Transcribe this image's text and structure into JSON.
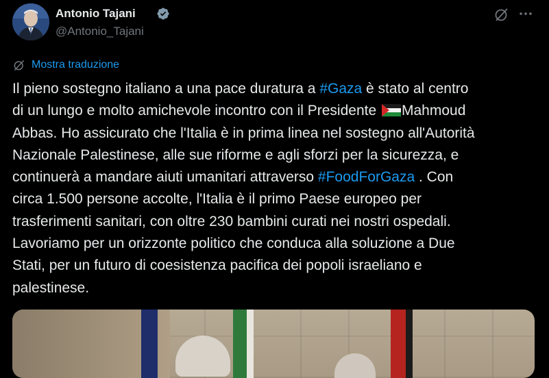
{
  "author": {
    "name": "Antonio Tajani",
    "handle": "@Antonio_Tajani"
  },
  "icons": {
    "verified": "verified-badge-icon",
    "grok": "grok-icon",
    "more": "more-options-icon",
    "translate": "translate-icon"
  },
  "translate_label": "Mostra traduzione",
  "tweet": {
    "lines": [
      {
        "parts": [
          {
            "t": "Il pieno sostegno italiano a una pace duratura a "
          },
          {
            "t": "#Gaza",
            "tag": true
          },
          {
            "t": " è stato al centro"
          }
        ]
      },
      {
        "parts": [
          {
            "t": "di un lungo e molto amichevole incontro con il Presidente "
          },
          {
            "flag": true
          },
          {
            "t": "Mahmoud"
          }
        ]
      },
      {
        "parts": [
          {
            "t": "Abbas. Ho assicurato che l'Italia è in prima linea nel sostegno all'Autorità"
          }
        ]
      },
      {
        "parts": [
          {
            "t": "Nazionale Palestinese, alle sue riforme e agli sforzi per la sicurezza, e"
          }
        ]
      },
      {
        "parts": [
          {
            "t": "continuerà a mandare aiuti umanitari attraverso "
          },
          {
            "t": "#FoodForGaza",
            "tag": true
          },
          {
            "t": " . Con"
          }
        ]
      },
      {
        "parts": [
          {
            "t": "circa 1.500 persone accolte, l'Italia è il primo Paese europeo per"
          }
        ]
      },
      {
        "parts": [
          {
            "t": "trasferimenti sanitari, con oltre 230 bambini curati nei nostri ospedali."
          }
        ]
      },
      {
        "parts": [
          {
            "t": "Lavoriamo per un orizzonte politico che conduca alla soluzione a Due"
          }
        ]
      },
      {
        "parts": [
          {
            "t": "Stati, per un futuro di coesistenza pacifica dei popoli israeliano e"
          }
        ]
      },
      {
        "parts": [
          {
            "t": "palestinese."
          }
        ]
      }
    ]
  },
  "colors": {
    "background": "#000000",
    "text": "#e7e9ea",
    "secondary": "#71767b",
    "accent": "#1d9bf0"
  }
}
